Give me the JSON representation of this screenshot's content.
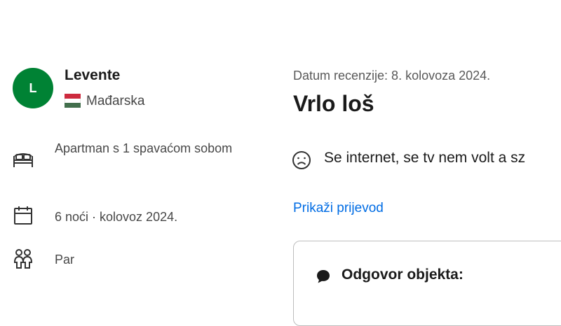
{
  "reviewer": {
    "initial": "L",
    "name": "Levente",
    "country": "Mađarska",
    "avatar_color": "#008234",
    "flag_colors": [
      "#cd2a3e",
      "#ffffff",
      "#436f4d"
    ]
  },
  "stay": {
    "room": "Apartman s 1 spavaćom sobom",
    "nights": "6 noći · kolovoz 2024.",
    "traveler_type": "Par",
    "icons": [
      "bed-icon",
      "calendar-icon",
      "group-icon"
    ]
  },
  "review": {
    "date": "Datum recenzije: 8. kolovoza 2024.",
    "title": "Vrlo loš",
    "negative_text": "Se internet, se tv nem volt a sz",
    "negative_icon": "sad-face-icon",
    "translate_link": "Prikaži prijevod"
  },
  "response": {
    "label": "Odgovor objekta:",
    "icon": "speech-bubble-icon"
  },
  "colors": {
    "link": "#006ce4",
    "text": "#1a1a1a",
    "muted": "#474747"
  }
}
